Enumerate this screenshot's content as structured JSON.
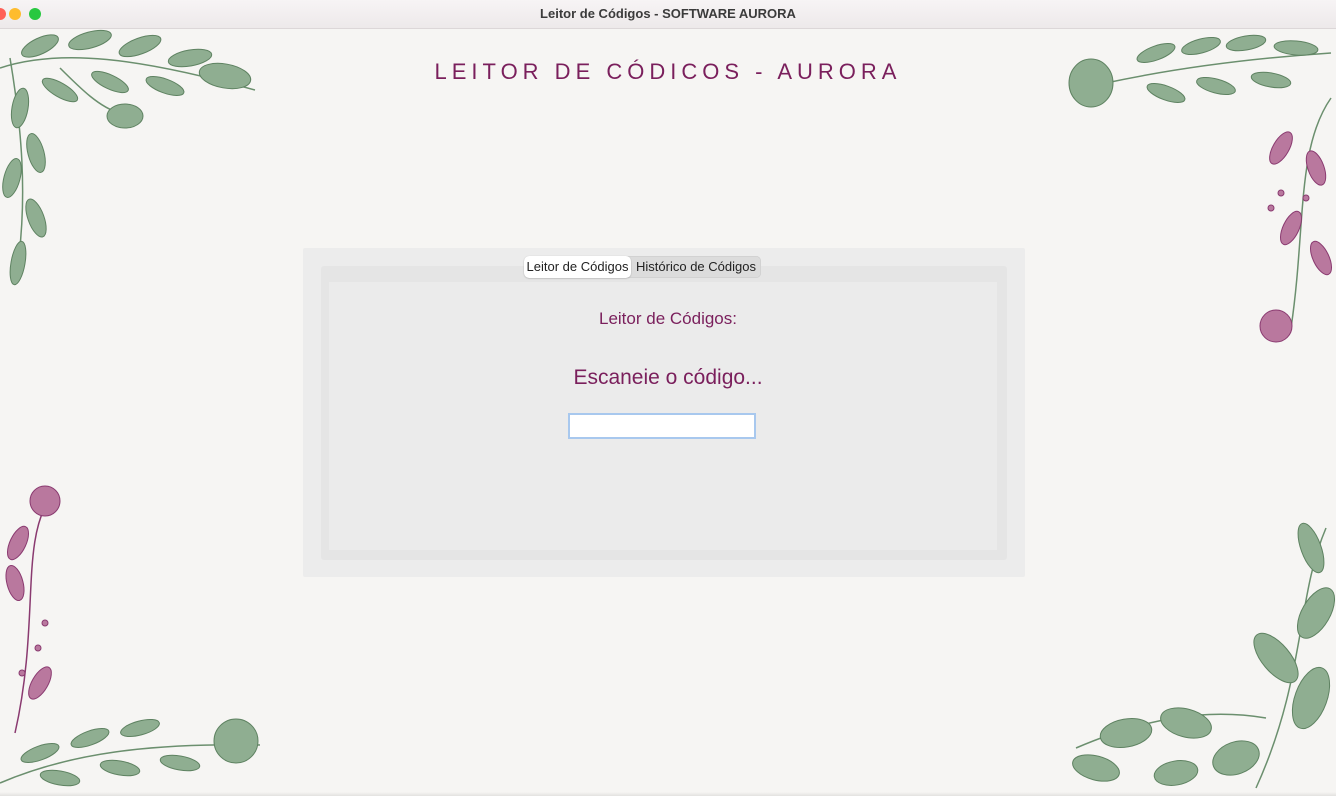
{
  "window": {
    "title": "Leitor de Códigos - SOFTWARE AURORA"
  },
  "header": {
    "app_title": "LEITOR DE CÓDICOS - AURORA"
  },
  "tabs": [
    {
      "label": "Leitor de Códigos",
      "active": true
    },
    {
      "label": "Histórico de Códigos",
      "active": false
    }
  ],
  "reader": {
    "heading": "Leitor de Códigos:",
    "prompt": "Escaneie o código...",
    "input_value": "",
    "input_placeholder": ""
  },
  "colors": {
    "accent": "#7a1f5c",
    "leaf_green": "#6b8f6e",
    "flower_purple": "#8a3a70",
    "background": "#f6f5f3"
  },
  "icons": [
    "close-window-icon",
    "minimize-window-icon",
    "maximize-window-icon",
    "floral-decoration"
  ]
}
